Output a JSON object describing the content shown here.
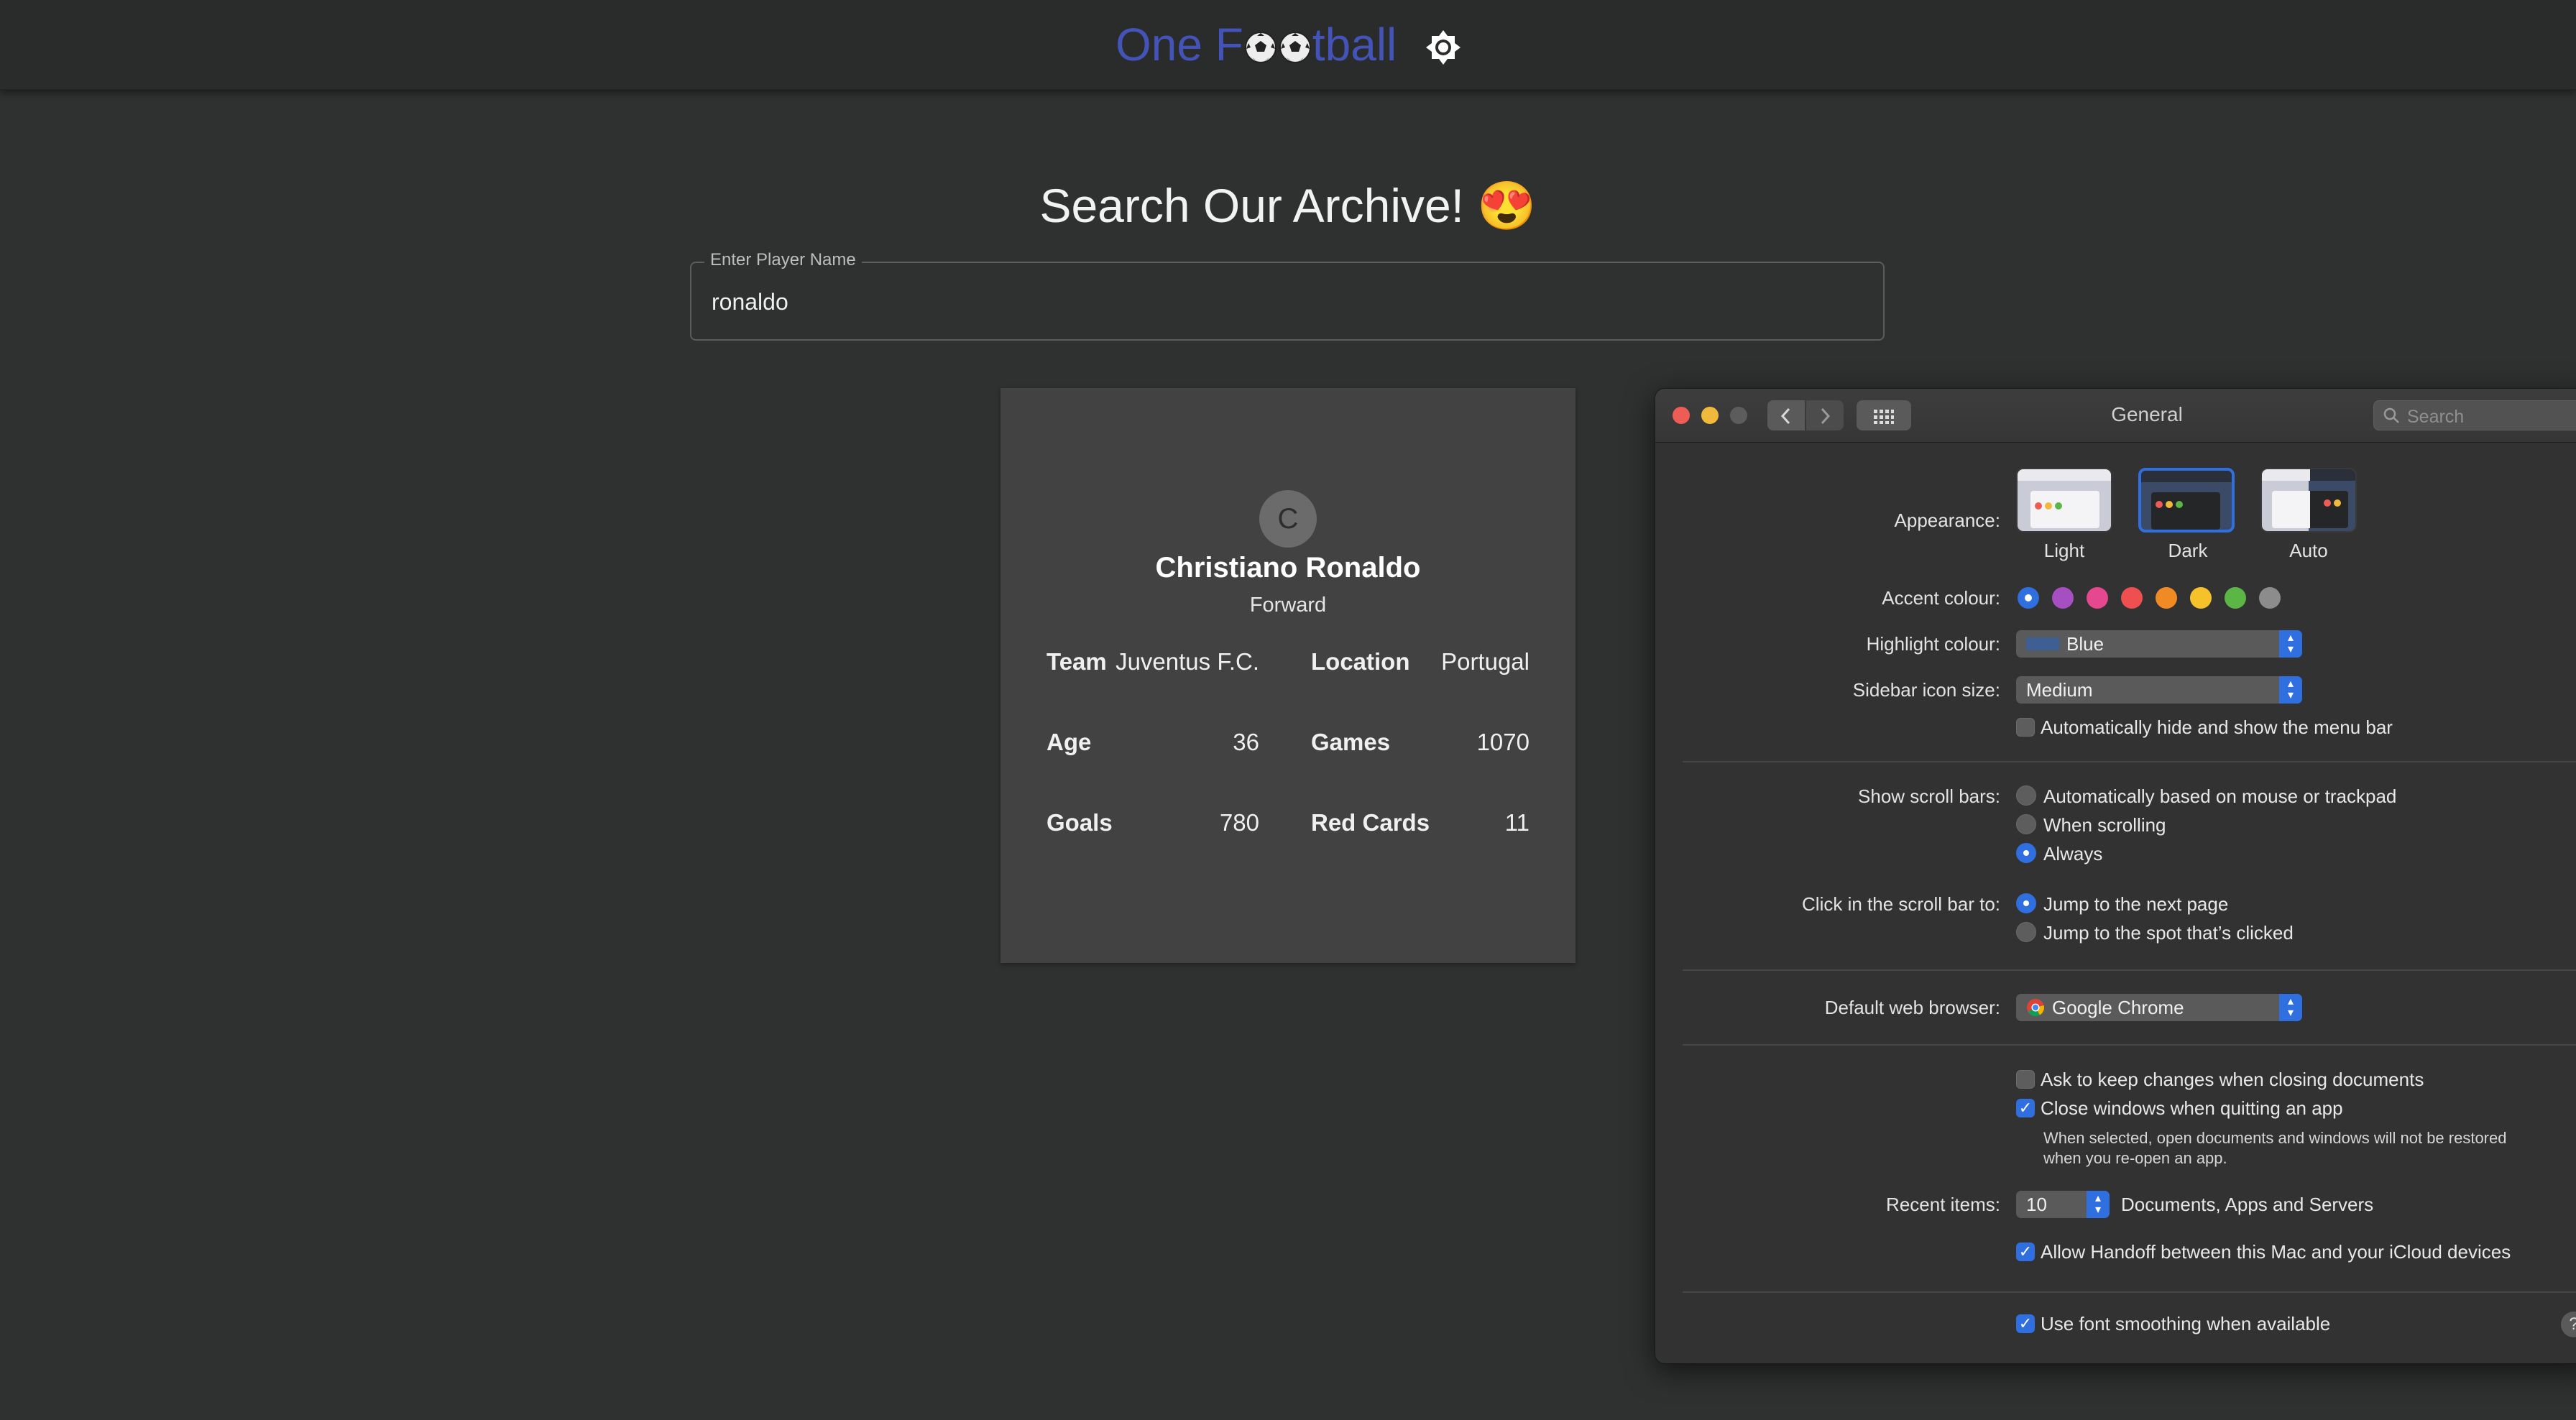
{
  "app": {
    "brand_prefix": "One F",
    "brand_suffix": "tball",
    "accent_color": "#4453b7"
  },
  "search": {
    "heading": "Search Our Archive! 😍",
    "field_label": "Enter Player Name",
    "value": "ronaldo"
  },
  "player": {
    "avatar_initial": "C",
    "name": "Christiano Ronaldo",
    "position": "Forward",
    "stats": {
      "team_label": "Team",
      "team": "Juventus F.C.",
      "location_label": "Location",
      "location": "Portugal",
      "age_label": "Age",
      "age": "36",
      "games_label": "Games",
      "games": "1070",
      "goals_label": "Goals",
      "goals": "780",
      "red_cards_label": "Red Cards",
      "red_cards": "11"
    }
  },
  "prefs": {
    "title": "General",
    "search_placeholder": "Search",
    "appearance": {
      "label": "Appearance:",
      "options": [
        "Light",
        "Dark",
        "Auto"
      ],
      "selected": "Dark"
    },
    "accent_colour": {
      "label": "Accent colour:",
      "colors": [
        "#2f6fe0",
        "#a54fc2",
        "#e6488f",
        "#ee4f50",
        "#f08a24",
        "#f6c22b",
        "#5cb646",
        "#8c8c8c"
      ]
    },
    "highlight_colour": {
      "label": "Highlight colour:",
      "value": "Blue",
      "swatch": "#3e5f94"
    },
    "sidebar_icon_size": {
      "label": "Sidebar icon size:",
      "value": "Medium"
    },
    "menu_bar": {
      "label": "Automatically hide and show the menu bar",
      "checked": false
    },
    "scroll_bars": {
      "label": "Show scroll bars:",
      "options": [
        "Automatically based on mouse or trackpad",
        "When scrolling",
        "Always"
      ],
      "selected": "Always"
    },
    "scroll_click": {
      "label": "Click in the scroll bar to:",
      "options": [
        "Jump to the next page",
        "Jump to the spot that’s clicked"
      ],
      "selected": "Jump to the next page"
    },
    "browser": {
      "label": "Default web browser:",
      "value": "Google Chrome"
    },
    "ask_keep_changes": {
      "label": "Ask to keep changes when closing documents",
      "checked": false
    },
    "close_windows": {
      "label": "Close windows when quitting an app",
      "checked": true,
      "note_line1": "When selected, open documents and windows will not be restored",
      "note_line2": "when you re-open an app."
    },
    "recent_items": {
      "label": "Recent items:",
      "value": "10",
      "suffix": "Documents, Apps and Servers"
    },
    "handoff": {
      "label": "Allow Handoff between this Mac and your iCloud devices",
      "checked": true
    },
    "font_smoothing": {
      "label": "Use font smoothing when available",
      "checked": true
    },
    "help": "?"
  }
}
